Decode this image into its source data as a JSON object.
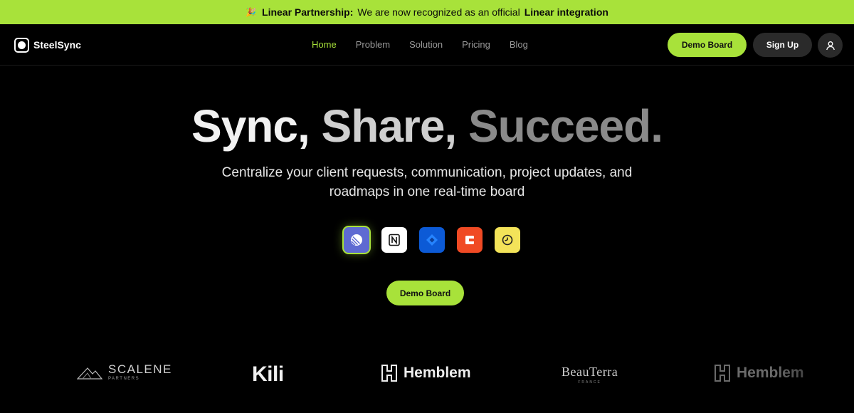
{
  "banner": {
    "emoji": "🎉",
    "prefix": "Linear Partnership:",
    "message": "We are now recognized as an official",
    "highlight": "Linear integration"
  },
  "brand": {
    "name": "SteelSync",
    "icon": "steelsync-logo-icon"
  },
  "nav": {
    "links": [
      "Home",
      "Problem",
      "Solution",
      "Pricing",
      "Blog"
    ],
    "active": "Home",
    "demo_label": "Demo Board",
    "signup_label": "Sign Up",
    "avatar_icon": "user-icon"
  },
  "hero": {
    "title_parts": [
      "Sync,",
      "Share,",
      "Succeed."
    ],
    "subtitle": "Centralize your client requests, communication, project updates, and roadmaps in one real-time board",
    "integrations": [
      "linear-icon",
      "notion-icon",
      "jira-icon",
      "coda-icon",
      "clock-integration-icon"
    ],
    "selected_integration": "linear-icon",
    "cta_label": "Demo Board"
  },
  "logos": {
    "scalene": {
      "main": "SCALENE",
      "sub": "PARTNERS"
    },
    "kili": "Kili",
    "hemblem": "Hemblem",
    "beauterra": {
      "main": "BeauTerra",
      "sub": "FRANCE"
    },
    "hemblem_faded": "Hemblem"
  },
  "colors": {
    "accent": "#a8e23a",
    "background": "#000000",
    "button_dark": "#2a2a2a"
  }
}
